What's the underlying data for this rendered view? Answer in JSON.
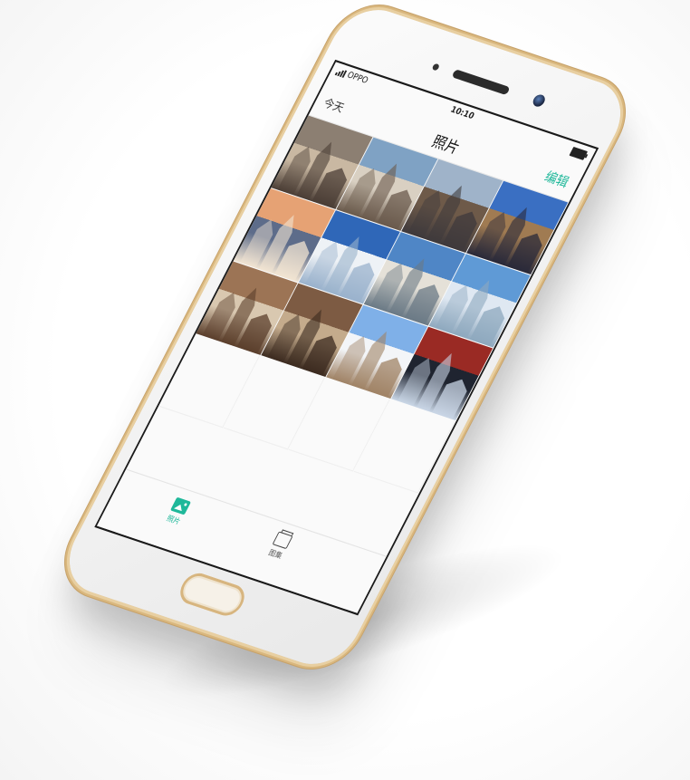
{
  "statusbar": {
    "carrier": "OPPO",
    "time": "10:10"
  },
  "navbar": {
    "left": "今天",
    "title": "照片",
    "right": "编辑"
  },
  "tabs": [
    {
      "label": "照片",
      "icon": "photo-icon",
      "active": true
    },
    {
      "label": "图集",
      "icon": "album-icon",
      "active": false
    }
  ],
  "colors": {
    "accent": "#1fb89a",
    "frame_gold": "#d9b77e",
    "body": "#f4f4f4"
  },
  "photos": [
    {
      "icon": "city-rooftops-photo",
      "colors": [
        "#8c7f72",
        "#c9b8a2",
        "#4b3e36"
      ]
    },
    {
      "icon": "cathedral-spires-photo",
      "colors": [
        "#7fa2c4",
        "#d9d0c2",
        "#6a5a4c"
      ]
    },
    {
      "icon": "gothic-towers-photo",
      "colors": [
        "#9fb3c9",
        "#6e5a49",
        "#3f3a3c"
      ]
    },
    {
      "icon": "castle-blue-sky-photo",
      "colors": [
        "#3a6fc2",
        "#a07b52",
        "#2a2a3a"
      ]
    },
    {
      "icon": "sunset-town-photo",
      "colors": [
        "#e6a274",
        "#5d6c8a",
        "#f1e4d2"
      ]
    },
    {
      "icon": "white-domes-photo",
      "colors": [
        "#2f67b8",
        "#eef2f6",
        "#9ab2cc"
      ]
    },
    {
      "icon": "seaside-cliffs-photo",
      "colors": [
        "#4f86c6",
        "#e5e1d8",
        "#6b7a86"
      ]
    },
    {
      "icon": "sky-clouds-photo",
      "colors": [
        "#5f9ad6",
        "#dfe8f2",
        "#8ea8be"
      ]
    },
    {
      "icon": "timber-houses-photo",
      "colors": [
        "#9c7455",
        "#d9c8b0",
        "#5b3f2c"
      ]
    },
    {
      "icon": "old-facade-photo",
      "colors": [
        "#7d5b43",
        "#c4ab8c",
        "#3c2b20"
      ]
    },
    {
      "icon": "snowy-mountain-photo",
      "colors": [
        "#7fb0e8",
        "#f3f5f8",
        "#a08366"
      ]
    },
    {
      "icon": "pagoda-building-photo",
      "colors": [
        "#9a2a24",
        "#1f2430",
        "#c9d6e6"
      ]
    }
  ]
}
